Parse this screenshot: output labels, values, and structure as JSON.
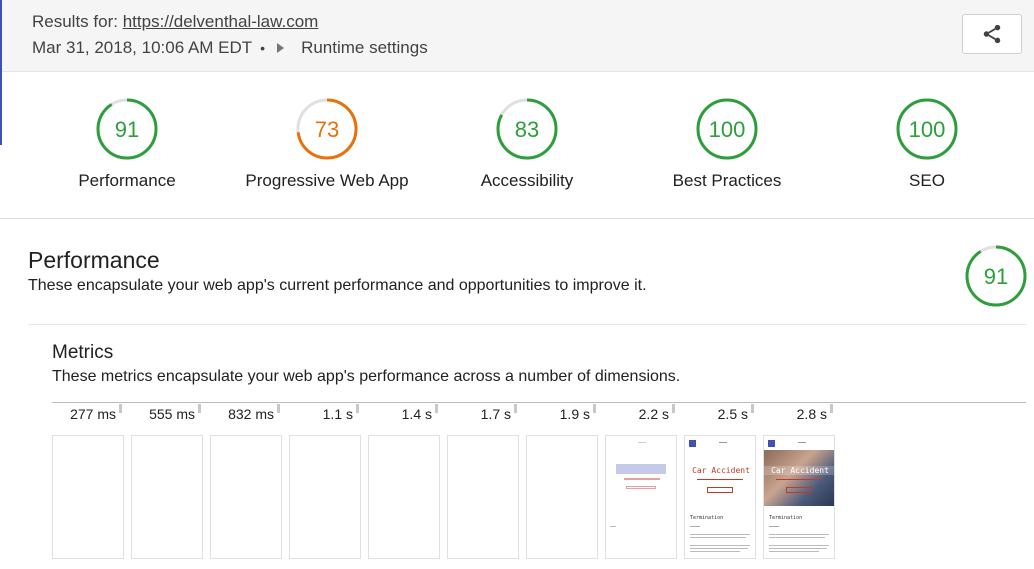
{
  "header": {
    "results_prefix": "Results for:",
    "url": "https://delventhal-law.com",
    "timestamp": "Mar 31, 2018, 10:06 AM EDT",
    "bullet": "•",
    "runtime_settings": "Runtime settings",
    "share_icon": "share-icon"
  },
  "categories": [
    {
      "score": "91",
      "label": "Performance",
      "color": "#2e9e3c",
      "fraction": 0.91
    },
    {
      "score": "73",
      "label": "Progressive Web App",
      "color": "#e8710a",
      "fraction": 0.73
    },
    {
      "score": "83",
      "label": "Accessibility",
      "color": "#2e9e3c",
      "fraction": 0.83
    },
    {
      "score": "100",
      "label": "Best Practices",
      "color": "#2e9e3c",
      "fraction": 1.0
    },
    {
      "score": "100",
      "label": "SEO",
      "color": "#2e9e3c",
      "fraction": 1.0
    }
  ],
  "performance": {
    "title": "Performance",
    "description": "These encapsulate your web app's current performance and opportunities to improve it.",
    "score": "91",
    "fraction": 0.91,
    "color": "#2e9e3c"
  },
  "metrics": {
    "title": "Metrics",
    "description": "These metrics encapsulate your web app's performance across a number of dimensions."
  },
  "filmstrip": {
    "times": [
      "277 ms",
      "555 ms",
      "832 ms",
      "1.1 s",
      "1.4 s",
      "1.7 s",
      "1.9 s",
      "2.2 s",
      "2.5 s",
      "2.8 s"
    ],
    "frame_text": {
      "car_accident": "Car Accident",
      "termination": "Termination"
    }
  },
  "colors": {
    "pass": "#2e9e3c",
    "average": "#e8710a",
    "track": "#e0e0e0"
  }
}
